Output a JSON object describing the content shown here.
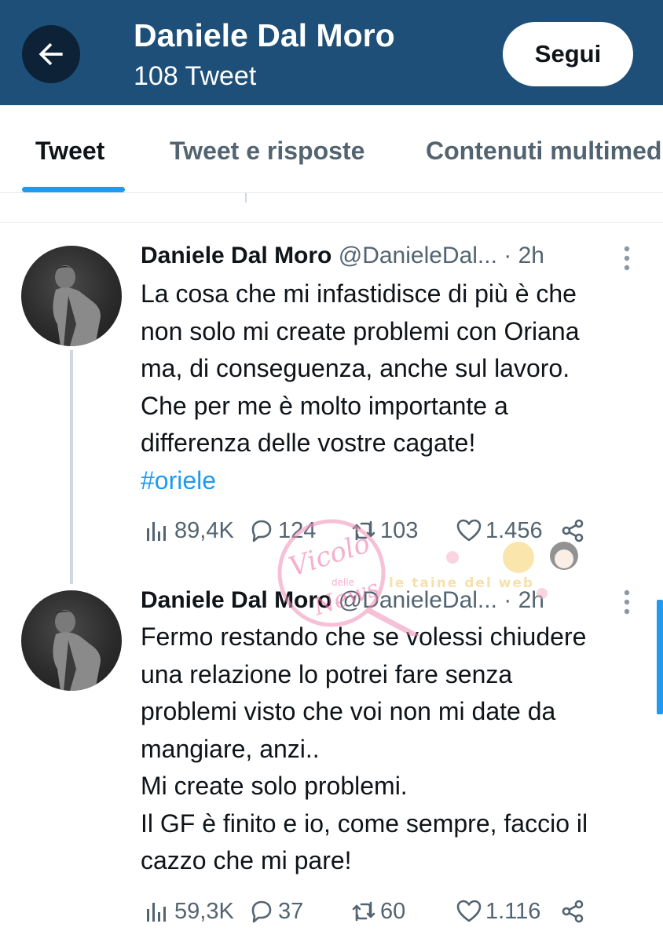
{
  "header": {
    "title": "Daniele Dal Moro",
    "subtitle": "108 Tweet",
    "follow_label": "Segui"
  },
  "tabs": [
    {
      "label": "Tweet",
      "active": true
    },
    {
      "label": "Tweet e risposte",
      "active": false
    },
    {
      "label": "Contenuti multimediali",
      "active": false
    }
  ],
  "tweets": [
    {
      "name": "Daniele Dal Moro",
      "handle": "@DanieleDal...",
      "time": "· 2h",
      "lines": [
        "La cosa che mi infastidisce di più è che",
        "non solo mi create problemi con Oriana",
        "ma, di conseguenza, anche sul lavoro.",
        "Che per me è molto importante a",
        "differenza delle vostre cagate!"
      ],
      "hashtag": "#oriele",
      "views": "89,4K",
      "replies": "124",
      "retweets": "103",
      "likes": "1.456"
    },
    {
      "name": "Daniele Dal Moro",
      "handle": "@DanieleDal...",
      "time": "· 2h",
      "lines": [
        "Fermo restando che se volessi chiudere",
        "una relazione lo potrei fare senza",
        "problemi visto che voi non mi date da",
        "mangiare, anzi..",
        "Mi create solo problemi.",
        "Il GF è finito e io, come sempre, faccio il",
        "cazzo che mi pare!"
      ],
      "views": "59,3K",
      "replies": "37",
      "retweets": "60",
      "likes": "1.116"
    }
  ],
  "watermark": {
    "text_a": "Vicolo",
    "text_b": "delle",
    "text_c": "News",
    "text_d": "le taine del web"
  },
  "colors": {
    "header_bg": "#1d4f78",
    "accent": "#1d9bf0",
    "secondary_text": "#536471"
  },
  "icons": [
    "back-arrow-icon",
    "more-icon",
    "views-icon",
    "reply-icon",
    "retweet-icon",
    "like-icon",
    "share-icon"
  ]
}
